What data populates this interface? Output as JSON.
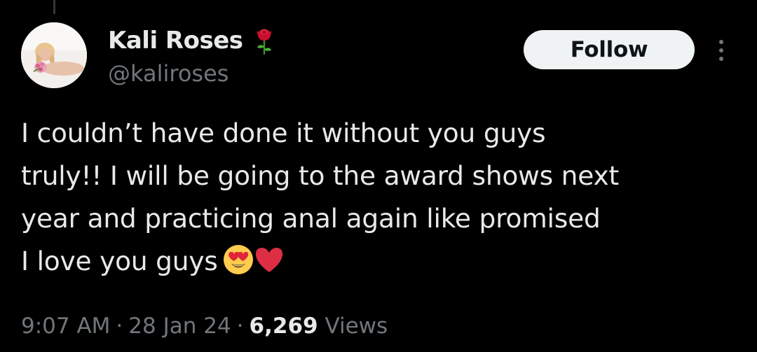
{
  "author": {
    "display_name": "Kali Roses",
    "handle": "@kaliroses",
    "badge_icon": "rose-emoji-icon",
    "avatar": "profile-photo"
  },
  "actions": {
    "follow_label": "Follow",
    "more_icon": "more-options-icon"
  },
  "tweet": {
    "lines": [
      "I couldn’t have done it without you guys",
      "truly!! I will be going to the award shows next",
      "year and practicing anal again like promised",
      "I love you guys"
    ],
    "emojis": [
      "heart-eyes-emoji-icon",
      "red-heart-emoji-icon"
    ]
  },
  "meta": {
    "time": "9:07 AM",
    "date": "28 Jan 24",
    "views_count": "6,269",
    "views_label": "Views",
    "separator": "·"
  },
  "colors": {
    "background": "#000000",
    "primary_text": "#e7e9ea",
    "secondary_text": "#71767b",
    "follow_button_bg": "#eff3f4",
    "follow_button_text": "#0f1419"
  }
}
